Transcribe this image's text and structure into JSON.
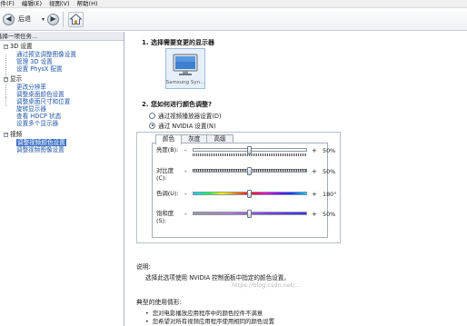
{
  "menu": {
    "items": [
      "文件(F)",
      "编辑(E)",
      "视图(V)",
      "帮助(H)"
    ]
  },
  "toolbar": {
    "back_label": "后退",
    "dropdown_glyph": "▾",
    "back_icon": "arrow-left",
    "forward_icon": "arrow-right",
    "home_icon": "home"
  },
  "left_panel": {
    "title": "选择一项任务...",
    "tree": [
      {
        "label": "3D 设置",
        "type": "category"
      },
      {
        "label": "通过预览调整图像设置",
        "type": "item"
      },
      {
        "label": "管理 3D 设置",
        "type": "item"
      },
      {
        "label": "设置 PhysX 配置",
        "type": "item"
      },
      {
        "label": "显示",
        "type": "category"
      },
      {
        "label": "更改分辨率",
        "type": "item"
      },
      {
        "label": "调整桌面颜色设置",
        "type": "item"
      },
      {
        "label": "调整桌面尺寸和位置",
        "type": "item"
      },
      {
        "label": "旋转显示器",
        "type": "item"
      },
      {
        "label": "查看 HDCP 状态",
        "type": "item"
      },
      {
        "label": "设置多个显示器",
        "type": "item"
      },
      {
        "label": "视频",
        "type": "category"
      },
      {
        "label": "调整视频颜色设置",
        "type": "item",
        "selected": true
      },
      {
        "label": "调整视频图像设置",
        "type": "item"
      }
    ],
    "toggle_glyph": "−"
  },
  "main": {
    "step1_title": "1. 选择需要变更的显示器",
    "display_name": "Samsung Syn...",
    "step2_title": "2. 您如何进行颜色调整?",
    "radio_player": "通过视频播放器设置(D)",
    "radio_nvidia": "通过 NVIDIA 设置(N)",
    "selected_radio": "nvidia",
    "tabs": [
      "颜色",
      "灰度",
      "高级"
    ],
    "active_tab": "颜色",
    "sliders": [
      {
        "label": "亮度(B):",
        "value": "50%",
        "level": 0.5
      },
      {
        "label": "对比度(C):",
        "value": "50%",
        "level": 0.5
      },
      {
        "label": "色调(U):",
        "value": "180°",
        "level": 0.5
      },
      {
        "label": "饱和度(S):",
        "value": "50%",
        "level": 0.5
      }
    ],
    "minus": "-",
    "plus": "+",
    "description_title": "说明:",
    "description_text": "选择此选项使用 NVIDIA 控制面板中指定的颜色设置。",
    "usage_title": "典型的使用情形:",
    "usage_bullets": [
      "您对电影播放应用程序中的颜色控件不满意",
      "您希望对所有视频应用程序使用相同的颜色设置"
    ]
  },
  "watermark": "https://blog.csdn.net/..."
}
